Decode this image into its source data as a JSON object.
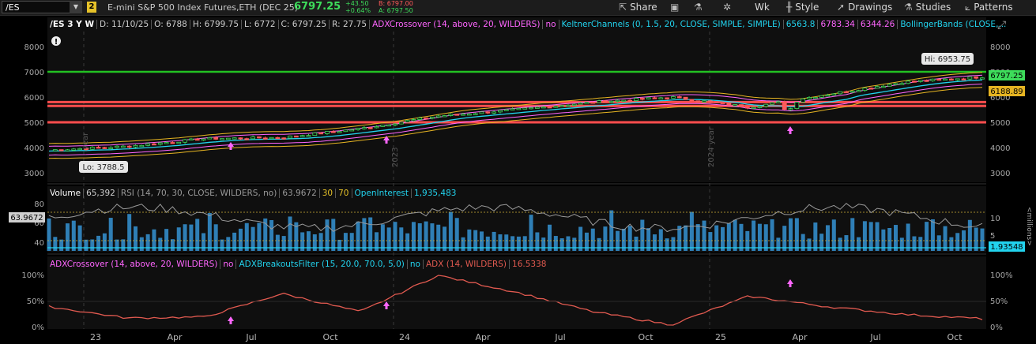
{
  "toolbar": {
    "symbol": "/ES",
    "link_num": "2",
    "description": "E-mini S&P 500 Index Futures,ETH (DEC 25)",
    "last": "6797.25",
    "net_change": "+43.50",
    "pct_change": "+0.64%",
    "bid": "B: 6797.00",
    "ask": "A: 6797.50",
    "share": "Share",
    "aggregation": "Wk",
    "style": "Style",
    "drawings": "Drawings",
    "studies": "Studies",
    "patterns": "Patterns"
  },
  "price_header": {
    "symbol": "/ES 3 Y W",
    "date": "D: 11/10/25",
    "open": "O: 6788",
    "high": "H: 6799.75",
    "low": "L: 6772",
    "close": "C: 6797.25",
    "range": "R: 27.75",
    "adx_crossover": "ADXCrossover (14, above, 20, WILDERS)",
    "adx_crossover_val": "no",
    "keltner": "KeltnerChannels (0, 1.5, 20, CLOSE, SIMPLE, SIMPLE)",
    "kc1": "6563.8",
    "kc2": "6783.34",
    "kc3": "6344.26",
    "bollinger": "BollingerBands (CLOSE,..."
  },
  "price_panel": {
    "y_ticks": [
      "8000",
      "7000",
      "6000",
      "5000",
      "4000",
      "3000"
    ],
    "hi_label": "Hi: 6953.75",
    "lo_label": "Lo: 3788.5",
    "last_bubble": "6797.25",
    "bb_bubble": "6188.89",
    "year_marks": [
      "year",
      "2023",
      "2024 year"
    ],
    "info_icon": "!"
  },
  "volume_header": {
    "volume": "Volume",
    "volume_val": "65,392",
    "rsi": "RSI (14, 70, 30, CLOSE, WILDERS, no)",
    "rsi_val": "63.9672",
    "ob": "30",
    "os": "70",
    "oi": "OpenInterest",
    "oi_val": "1,935,483"
  },
  "volume_panel": {
    "left_ticks": [
      "80",
      "60",
      "40"
    ],
    "right_ticks": [
      "10",
      "5"
    ],
    "unit": "<millions>",
    "rsi_bubble": "63.9672",
    "oi_bubble": "1.93548"
  },
  "adx_header": {
    "crossover": "ADXCrossover (14, above, 20, WILDERS)",
    "crossover_val": "no",
    "breakouts": "ADXBreakoutsFilter (15, 20.0, 70.0, 5.0)",
    "breakouts_val": "no",
    "adx": "ADX (14, WILDERS)",
    "adx_val": "16.5338"
  },
  "adx_panel": {
    "ticks": [
      "100%",
      "50%",
      "0%"
    ]
  },
  "x_axis": [
    "23",
    "Apr",
    "Jul",
    "Oct",
    "24",
    "Apr",
    "Jul",
    "Oct",
    "25",
    "Apr",
    "Jul",
    "Oct"
  ],
  "colors": {
    "up": "#3ddc5a",
    "down": "#ff5a5a",
    "keltner": "#ff66ff",
    "bollinger": "#e6b422",
    "ema": "#22d3ee",
    "green_line": "#22c022",
    "red_line": "#ff4d4d",
    "adx": "#e25a50",
    "rsi": "#9a9a9a",
    "volume": "#2f7fb6"
  },
  "chart_data": [
    {
      "type": "line",
      "title": "/ES 3 Y W",
      "note": "weekly price (approx. closes, data units)",
      "x": [
        "2022-12",
        "2023-03",
        "2023-06",
        "2023-09",
        "2023-12",
        "2024-03",
        "2024-06",
        "2024-09",
        "2024-12",
        "2025-03",
        "2025-06",
        "2025-09",
        "2025-11"
      ],
      "series": [
        {
          "name": "/ES",
          "values": [
            3900,
            4050,
            4350,
            4400,
            4750,
            5250,
            5500,
            5800,
            6000,
            5600,
            6100,
            6600,
            6797.25
          ]
        }
      ],
      "ylim": [
        2700,
        8500
      ],
      "hlines": [
        7000,
        5800,
        5650,
        5000
      ],
      "high": 6953.75,
      "low": 3788.5
    },
    {
      "type": "line",
      "title": "ADX (14, WILDERS)",
      "x": [
        "2022-12",
        "2023-03",
        "2023-06",
        "2023-09",
        "2023-12",
        "2024-03",
        "2024-06",
        "2024-09",
        "2024-12",
        "2025-03",
        "2025-06",
        "2025-09",
        "2025-11"
      ],
      "series": [
        {
          "name": "ADX",
          "values": [
            40,
            18,
            20,
            65,
            30,
            100,
            68,
            30,
            5,
            60,
            40,
            25,
            16.5338
          ]
        }
      ],
      "ylim": [
        0,
        100
      ]
    }
  ]
}
